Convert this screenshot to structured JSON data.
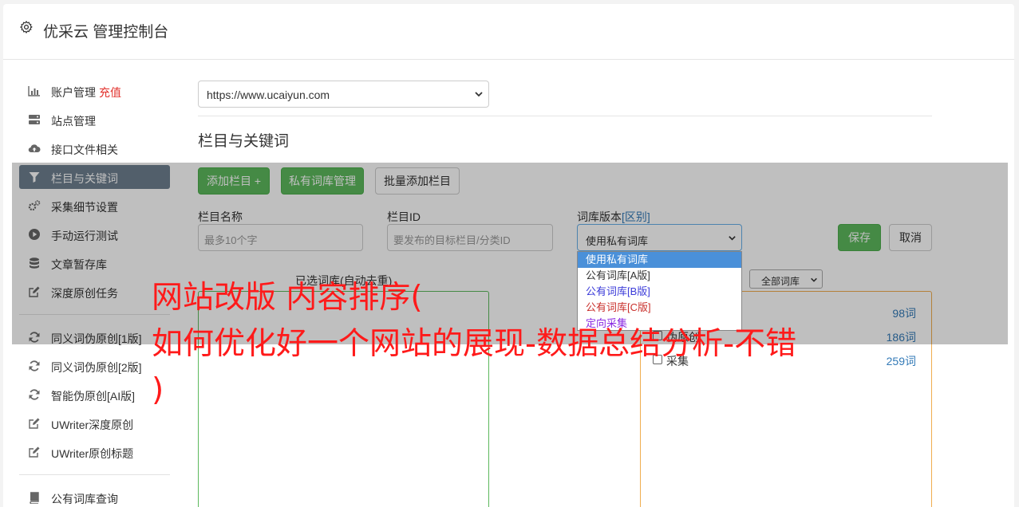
{
  "header": {
    "title": "优采云 管理控制台",
    "icon": "gear-icon"
  },
  "sidebar": {
    "items": [
      {
        "label": "账户管理",
        "badge": "充值",
        "icon": "bar-chart-icon"
      },
      {
        "label": "站点管理",
        "icon": "server-icon"
      },
      {
        "label": "接口文件相关",
        "icon": "cloud-upload-icon"
      },
      {
        "label": "栏目与关键词",
        "icon": "filter-icon",
        "active": true
      },
      {
        "label": "采集细节设置",
        "icon": "cogs-icon"
      },
      {
        "label": "手动运行测试",
        "icon": "play-circle-icon"
      },
      {
        "label": "文章暂存库",
        "icon": "database-icon"
      },
      {
        "label": "深度原创任务",
        "icon": "edit-icon"
      },
      {
        "label": "同义词伪原创[1版]",
        "icon": "refresh-icon"
      },
      {
        "label": "同义词伪原创[2版]",
        "icon": "refresh-icon"
      },
      {
        "label": "智能伪原创[AI版]",
        "icon": "refresh-icon"
      },
      {
        "label": "UWriter深度原创",
        "icon": "edit-icon"
      },
      {
        "label": "UWriter原创标题",
        "icon": "edit-icon"
      },
      {
        "label": "公有词库查询",
        "icon": "book-icon"
      }
    ]
  },
  "main": {
    "site_select": "https://www.ucaiyun.com",
    "section_title": "栏目与关键词",
    "buttons": {
      "add_column": "添加栏目 +",
      "private_lib": "私有词库管理",
      "batch_add": "批量添加栏目"
    },
    "form": {
      "column_name_label": "栏目名称",
      "column_name_placeholder": "最多10个字",
      "column_id_label": "栏目ID",
      "column_id_placeholder": "要发布的目标栏目/分类ID",
      "version_label": "词库版本",
      "version_label_link": "[区别]",
      "version_value": "使用私有词库",
      "save": "保存",
      "cancel": "取消"
    },
    "version_options": [
      {
        "label": "使用私有词库",
        "color": "#ffffff",
        "selected": true
      },
      {
        "label": "公有词库[A版]",
        "color": "#333333"
      },
      {
        "label": "公有词库[B版]",
        "color": "#3b3bd9"
      },
      {
        "label": "公有词库[C版]",
        "color": "#c9302c"
      },
      {
        "label": "定向采集",
        "color": "#8a2be2"
      }
    ],
    "selected_caption": "已选词库(自动去重)",
    "filter_select": "全部词库",
    "library_rows": [
      {
        "name": "",
        "count": "98词"
      },
      {
        "name": "伪原创",
        "count": "186词"
      },
      {
        "name": "采集",
        "count": "259词"
      }
    ]
  },
  "headline": {
    "line1": "网站改版 内容排序(",
    "line2": "如何优化好一个网站的展现-数据总结分析-不错",
    "line3": ")",
    "color": "#ff1a1a"
  }
}
